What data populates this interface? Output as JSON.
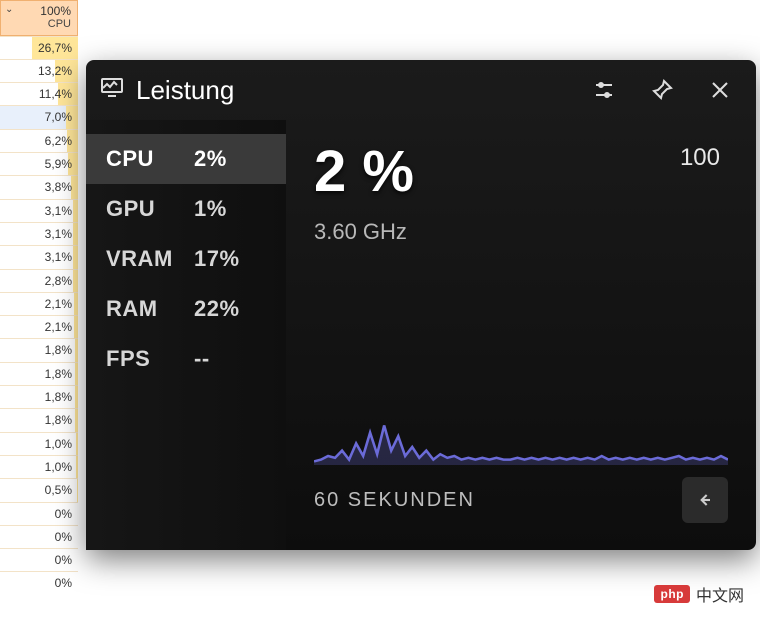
{
  "cpu_column": {
    "header_value": "100%",
    "header_label": "CPU",
    "selected_index": 3,
    "rows": [
      {
        "pct": 26.7,
        "text": "26,7%"
      },
      {
        "pct": 13.2,
        "text": "13,2%"
      },
      {
        "pct": 11.4,
        "text": "11,4%"
      },
      {
        "pct": 7.0,
        "text": "7,0%"
      },
      {
        "pct": 6.2,
        "text": "6,2%"
      },
      {
        "pct": 5.9,
        "text": "5,9%"
      },
      {
        "pct": 3.8,
        "text": "3,8%"
      },
      {
        "pct": 3.1,
        "text": "3,1%"
      },
      {
        "pct": 3.1,
        "text": "3,1%"
      },
      {
        "pct": 3.1,
        "text": "3,1%"
      },
      {
        "pct": 2.8,
        "text": "2,8%"
      },
      {
        "pct": 2.1,
        "text": "2,1%"
      },
      {
        "pct": 2.1,
        "text": "2,1%"
      },
      {
        "pct": 1.8,
        "text": "1,8%"
      },
      {
        "pct": 1.8,
        "text": "1,8%"
      },
      {
        "pct": 1.8,
        "text": "1,8%"
      },
      {
        "pct": 1.8,
        "text": "1,8%"
      },
      {
        "pct": 1.0,
        "text": "1,0%"
      },
      {
        "pct": 1.0,
        "text": "1,0%"
      },
      {
        "pct": 0.5,
        "text": "0,5%"
      },
      {
        "pct": 0.0,
        "text": "0%"
      },
      {
        "pct": 0.0,
        "text": "0%"
      },
      {
        "pct": 0.0,
        "text": "0%"
      },
      {
        "pct": 0.0,
        "text": "0%"
      }
    ]
  },
  "overlay": {
    "title": "Leistung",
    "metrics": [
      {
        "label": "CPU",
        "value": "2%"
      },
      {
        "label": "GPU",
        "value": "1%"
      },
      {
        "label": "VRAM",
        "value": "17%"
      },
      {
        "label": "RAM",
        "value": "22%"
      },
      {
        "label": "FPS",
        "value": "--"
      }
    ],
    "active_metric": 0,
    "main_value": "2 %",
    "frequency": "3.60 GHz",
    "y_max": "100",
    "x_label": "60 SEKUNDEN"
  },
  "chart_data": {
    "type": "line",
    "title": "CPU",
    "xlabel": "60 SEKUNDEN",
    "ylabel": "",
    "ylim": [
      0,
      100
    ],
    "x_seconds": 60,
    "values": [
      2,
      3,
      5,
      4,
      8,
      3,
      12,
      5,
      18,
      6,
      22,
      8,
      16,
      5,
      10,
      4,
      8,
      3,
      6,
      4,
      5,
      3,
      4,
      3,
      4,
      3,
      4,
      3,
      3,
      4,
      3,
      4,
      3,
      4,
      3,
      4,
      3,
      4,
      3,
      4,
      3,
      5,
      3,
      4,
      3,
      4,
      3,
      4,
      3,
      4,
      3,
      4,
      5,
      3,
      4,
      3,
      4,
      3,
      5,
      3
    ]
  },
  "watermark": {
    "badge": "php",
    "text": "中文网"
  }
}
